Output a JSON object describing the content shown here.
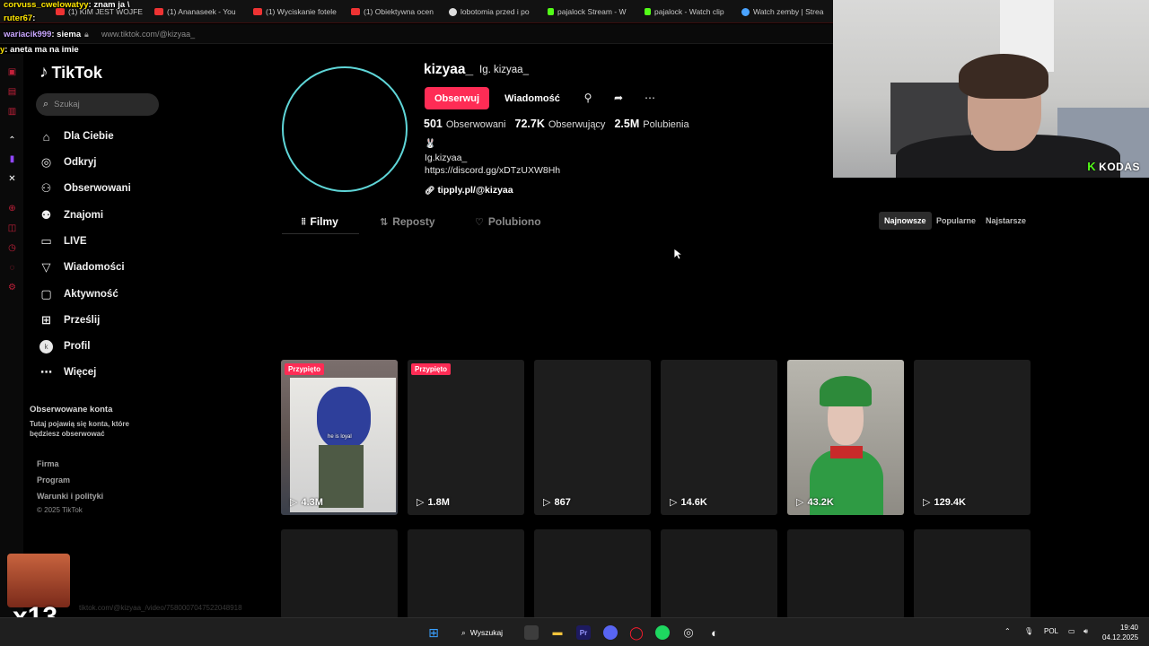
{
  "browser": {
    "tabs": [
      {
        "label": "(1) KIM JEST WOJFE",
        "color": "#e33"
      },
      {
        "label": "(1) Ananaseek - You",
        "color": "#e33"
      },
      {
        "label": "(1) Wyciskanie fotele",
        "color": "#e33"
      },
      {
        "label": "(1) Obiektywna ocen",
        "color": "#e33"
      },
      {
        "label": "lobotomia przed i po",
        "color": "#ddd"
      },
      {
        "label": "pajalock Stream - W",
        "color": "#53fc18"
      },
      {
        "label": "pajalock - Watch clip",
        "color": "#53fc18"
      },
      {
        "label": "Watch zemby | Strea",
        "color": "#4aa3ff"
      }
    ],
    "url": "www.tiktok.com/@kizyaa_",
    "status_url": "tiktok.com/@kizyaa_/video/7580007047522048918"
  },
  "chat": [
    {
      "user": "corvuss_cwelowatyy",
      "text": ": znam ja \\",
      "color": "#ffe600"
    },
    {
      "user": "ruter67",
      "text": ":",
      "color": "#ffe600"
    },
    {
      "user": "wariacik999",
      "text": ": siema",
      "color": "#c9a6ff"
    },
    {
      "user": "y",
      "text": ": aneta ma na imie",
      "color": "#ffe600"
    }
  ],
  "sidebar": {
    "logo_text": "TikTok",
    "search_placeholder": "Szukaj",
    "items": [
      {
        "label": "Dla Ciebie",
        "icon": "home-icon"
      },
      {
        "label": "Odkryj",
        "icon": "compass-icon"
      },
      {
        "label": "Obserwowani",
        "icon": "following-icon"
      },
      {
        "label": "Znajomi",
        "icon": "friends-icon"
      },
      {
        "label": "LIVE",
        "icon": "live-icon"
      },
      {
        "label": "Wiadomości",
        "icon": "messages-icon"
      },
      {
        "label": "Aktywność",
        "icon": "activity-icon"
      },
      {
        "label": "Prześlij",
        "icon": "upload-icon"
      },
      {
        "label": "Profil",
        "icon": "profile-avatar",
        "avatar_letter": "k"
      },
      {
        "label": "Więcej",
        "icon": "more-icon"
      }
    ],
    "followed_title": "Obserwowane konta",
    "followed_desc": "Tutaj pojawią się konta, które będziesz obserwować",
    "footer_links": [
      "Firma",
      "Program",
      "Warunki i polityki"
    ],
    "copyright": "© 2025 TikTok"
  },
  "profile": {
    "username": "kizyaa_",
    "nickname": "Ig. kizyaa_",
    "follow_label": "Obserwuj",
    "message_label": "Wiadomość",
    "stats": [
      {
        "value": "501",
        "label": "Obserwowani"
      },
      {
        "value": "72.7K",
        "label": "Obserwujący"
      },
      {
        "value": "2.5M",
        "label": "Polubienia"
      }
    ],
    "bio_emoji": "🐰",
    "bio_lines": [
      "Ig.kizyaa_",
      "https://discord.gg/xDTzUXW8Hh"
    ],
    "link": "tipply.pl/@kizyaa",
    "ring_color": "#5fd6d8"
  },
  "content_tabs": [
    {
      "label": "Filmy",
      "icon": "grid-icon",
      "active": true
    },
    {
      "label": "Reposty",
      "icon": "repost-icon",
      "active": false
    },
    {
      "label": "Polubiono",
      "icon": "heart-icon",
      "active": false
    }
  ],
  "sort_options": [
    {
      "label": "Najnowsze",
      "active": true
    },
    {
      "label": "Popularne",
      "active": false
    },
    {
      "label": "Najstarsze",
      "active": false
    }
  ],
  "videos": [
    {
      "views": "4.3M",
      "pinned": "Przypięto",
      "has_thumb": true,
      "caption": "he is loyal"
    },
    {
      "views": "1.8M",
      "pinned": "Przypięto",
      "has_thumb": false
    },
    {
      "views": "867",
      "pinned": "",
      "has_thumb": false
    },
    {
      "views": "14.6K",
      "pinned": "",
      "has_thumb": false
    },
    {
      "views": "43.2K",
      "pinned": "",
      "has_thumb": true
    },
    {
      "views": "129.4K",
      "pinned": "",
      "has_thumb": false
    }
  ],
  "stream_overlay": {
    "brand": "KODAS",
    "emote_count": "x13"
  },
  "taskbar": {
    "search_label": "Wyszukaj",
    "language": "POL",
    "time": "19:40",
    "date": "04.12.2025"
  },
  "colors": {
    "accent": "#fe2c55",
    "background": "#000000",
    "kick_green": "#53fc18"
  }
}
